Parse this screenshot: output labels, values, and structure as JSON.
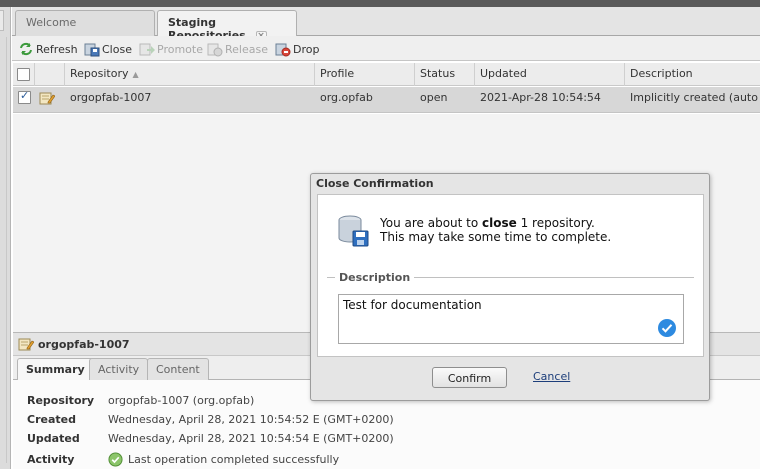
{
  "tabs": [
    {
      "label": "Welcome",
      "active": false
    },
    {
      "label": "Staging Repositories",
      "active": true,
      "closable": true
    }
  ],
  "toolbar": [
    {
      "label": "Refresh",
      "icon": "refresh-icon",
      "enabled": true
    },
    {
      "label": "Close",
      "icon": "close-repo-icon",
      "enabled": true
    },
    {
      "label": "Promote",
      "icon": "promote-icon",
      "enabled": false
    },
    {
      "label": "Release",
      "icon": "release-icon",
      "enabled": false
    },
    {
      "label": "Drop",
      "icon": "drop-icon",
      "enabled": true
    }
  ],
  "grid": {
    "columns": [
      "Repository",
      "Profile",
      "Status",
      "Updated",
      "Description"
    ],
    "sort_column": "Repository",
    "rows": [
      {
        "checked": true,
        "repository": "orgopfab-1007",
        "profile": "org.opfab",
        "status": "open",
        "updated": "2021-Apr-28 10:54:54",
        "description": "Implicitly created (auto staging)."
      }
    ]
  },
  "detail": {
    "title": "orgopfab-1007",
    "tabs": [
      "Summary",
      "Activity",
      "Content"
    ],
    "active_tab": "Summary",
    "fields": [
      {
        "label": "Repository",
        "value": "orgopfab-1007 (org.opfab)"
      },
      {
        "label": "Created",
        "value": "Wednesday, April 28, 2021 10:54:52 E (GMT+0200)"
      },
      {
        "label": "Updated",
        "value": "Wednesday, April 28, 2021 10:54:54 E (GMT+0200)"
      },
      {
        "label": "Activity",
        "value": "Last operation completed successfully",
        "icon": "success-icon"
      }
    ]
  },
  "modal": {
    "title": "Close Confirmation",
    "message_pre": "You are about to ",
    "message_bold": "close",
    "message_post": " 1 repository.",
    "message_line2": "This may take some time to complete.",
    "description_legend": "Description",
    "description_value": "Test for documentation",
    "confirm_label": "Confirm",
    "cancel_label": "Cancel"
  },
  "colors": {
    "selected_row": "#d7d7d7",
    "link": "#1d3e7a",
    "check_badge": "#2d8ae0",
    "success": "#5cb85c"
  }
}
